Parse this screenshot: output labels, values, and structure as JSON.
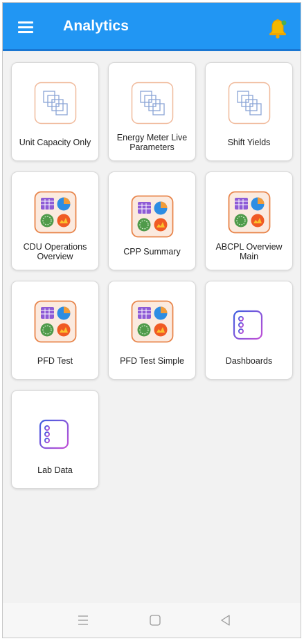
{
  "appbar": {
    "title": "Analytics",
    "menu_icon": "hamburger-menu-icon",
    "notification_icon": "bell-icon",
    "color": "#2196f3"
  },
  "tiles": [
    {
      "label": "Unit Capacity Only",
      "icon": "stacked-squares-icon"
    },
    {
      "label": "Energy Meter Live Parameters",
      "icon": "stacked-squares-icon"
    },
    {
      "label": "Shift Yields",
      "icon": "stacked-squares-icon"
    },
    {
      "label": "CDU Operations Overview",
      "icon": "dashboard-widgets-icon"
    },
    {
      "label": "CPP Summary",
      "icon": "dashboard-widgets-icon"
    },
    {
      "label": "ABCPL Overview Main",
      "icon": "dashboard-widgets-icon"
    },
    {
      "label": "PFD Test",
      "icon": "dashboard-widgets-icon"
    },
    {
      "label": "PFD Test Simple",
      "icon": "dashboard-widgets-icon"
    },
    {
      "label": "Dashboards",
      "icon": "list-icon"
    },
    {
      "label": "Lab Data",
      "icon": "list-icon"
    }
  ],
  "navbar": {
    "recents_icon": "recents-icon",
    "home_icon": "home-icon",
    "back_icon": "back-icon"
  }
}
